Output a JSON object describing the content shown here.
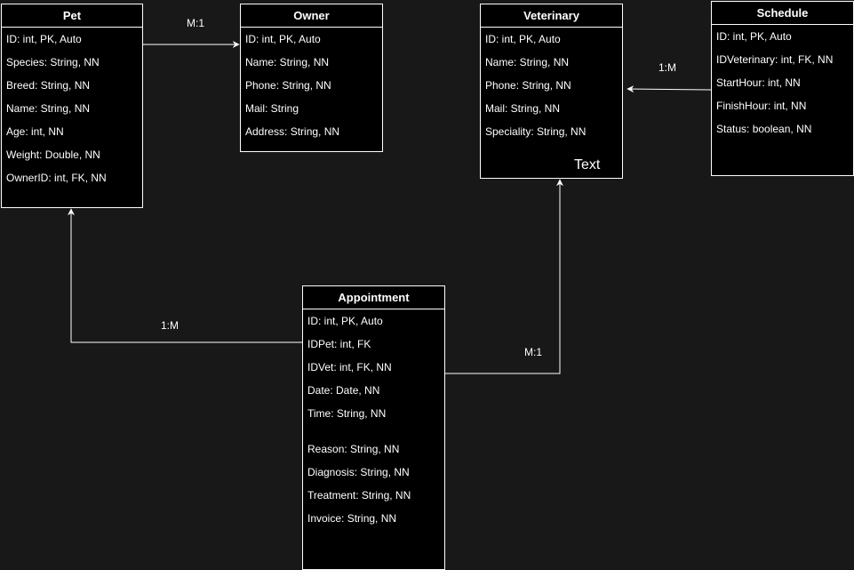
{
  "colors": {
    "background": "#181818",
    "entity_fill": "#000000",
    "stroke": "#ffffff",
    "text": "#ffffff"
  },
  "entities": {
    "pet": {
      "title": "Pet",
      "fields": [
        "ID: int, PK, Auto",
        "Species: String, NN",
        "Breed: String, NN",
        "Name: String, NN",
        "Age: int, NN",
        "Weight: Double, NN",
        "OwnerID: int, FK, NN"
      ]
    },
    "owner": {
      "title": "Owner",
      "fields": [
        "ID: int, PK, Auto",
        "Name: String, NN",
        "Phone: String, NN",
        "Mail: String",
        "Address: String, NN"
      ]
    },
    "veterinary": {
      "title": "Veterinary",
      "fields": [
        "ID: int, PK, Auto",
        "Name: String, NN",
        "Phone: String, NN",
        "Mail: String, NN",
        "Speciality: String, NN"
      ],
      "extra_text": "Text"
    },
    "schedule": {
      "title": "Schedule",
      "fields": [
        "ID: int, PK, Auto",
        "IDVeterinary: int, FK, NN",
        "StartHour: int, NN",
        "FinishHour: int, NN",
        "Status: boolean, NN"
      ]
    },
    "appointment": {
      "title": "Appointment",
      "fields": [
        "ID: int, PK, Auto",
        "IDPet: int, FK",
        "IDVet: int, FK, NN",
        "Date: Date, NN",
        "Time: String, NN",
        "Reason: String, NN",
        "Diagnosis: String, NN",
        "Treatment: String, NN",
        "Invoice: String, NN"
      ]
    }
  },
  "relations": {
    "pet_owner": "M:1",
    "schedule_veterinary": "1:M",
    "appointment_pet": "1:M",
    "appointment_veterinary": "M:1"
  }
}
